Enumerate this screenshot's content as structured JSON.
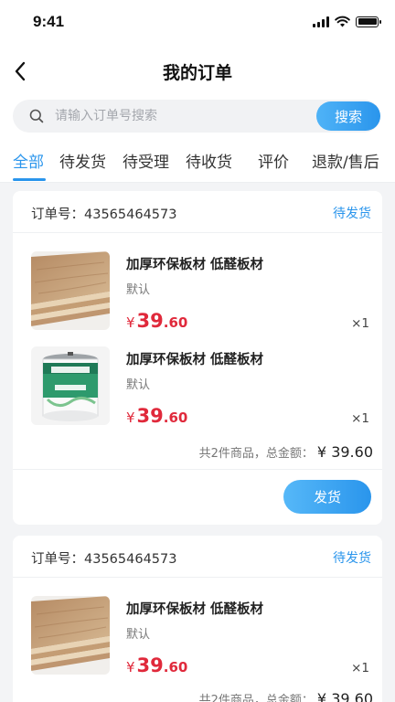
{
  "status_bar": {
    "time": "9:41"
  },
  "nav": {
    "title": "我的订单"
  },
  "search": {
    "placeholder": "请输入订单号搜索",
    "button": "搜索"
  },
  "tabs": [
    {
      "label": "全部",
      "active": true
    },
    {
      "label": "待发货",
      "active": false
    },
    {
      "label": "待受理",
      "active": false
    },
    {
      "label": "待收货",
      "active": false
    },
    {
      "label": "评价",
      "active": false
    },
    {
      "label": "退款/售后",
      "active": false
    }
  ],
  "orders": [
    {
      "order_no": "订单号：43565464573",
      "status": "待发货",
      "items": [
        {
          "name": "加厚环保板材 低醛板材",
          "spec": "默认",
          "currency": "¥",
          "price_int": "39",
          "price_dec": ".60",
          "qty": "×1",
          "image": "wood-board"
        },
        {
          "name": "加厚环保板材 低醛板材",
          "spec": "默认",
          "currency": "¥",
          "price_int": "39",
          "price_dec": ".60",
          "qty": "×1",
          "image": "paint-bucket"
        }
      ],
      "summary": "共2件商品，总金额：",
      "total": "¥ 39.60",
      "action": "发货"
    },
    {
      "order_no": "订单号：43565464573",
      "status": "待发货",
      "items": [
        {
          "name": "加厚环保板材 低醛板材",
          "spec": "默认",
          "currency": "¥",
          "price_int": "39",
          "price_dec": ".60",
          "qty": "×1",
          "image": "wood-board"
        }
      ],
      "summary": "共2件商品，总金额：",
      "total": "¥ 39.60"
    }
  ],
  "colors": {
    "accent": "#2a95ec",
    "price": "#e0293b",
    "background": "#f3f4f6"
  }
}
